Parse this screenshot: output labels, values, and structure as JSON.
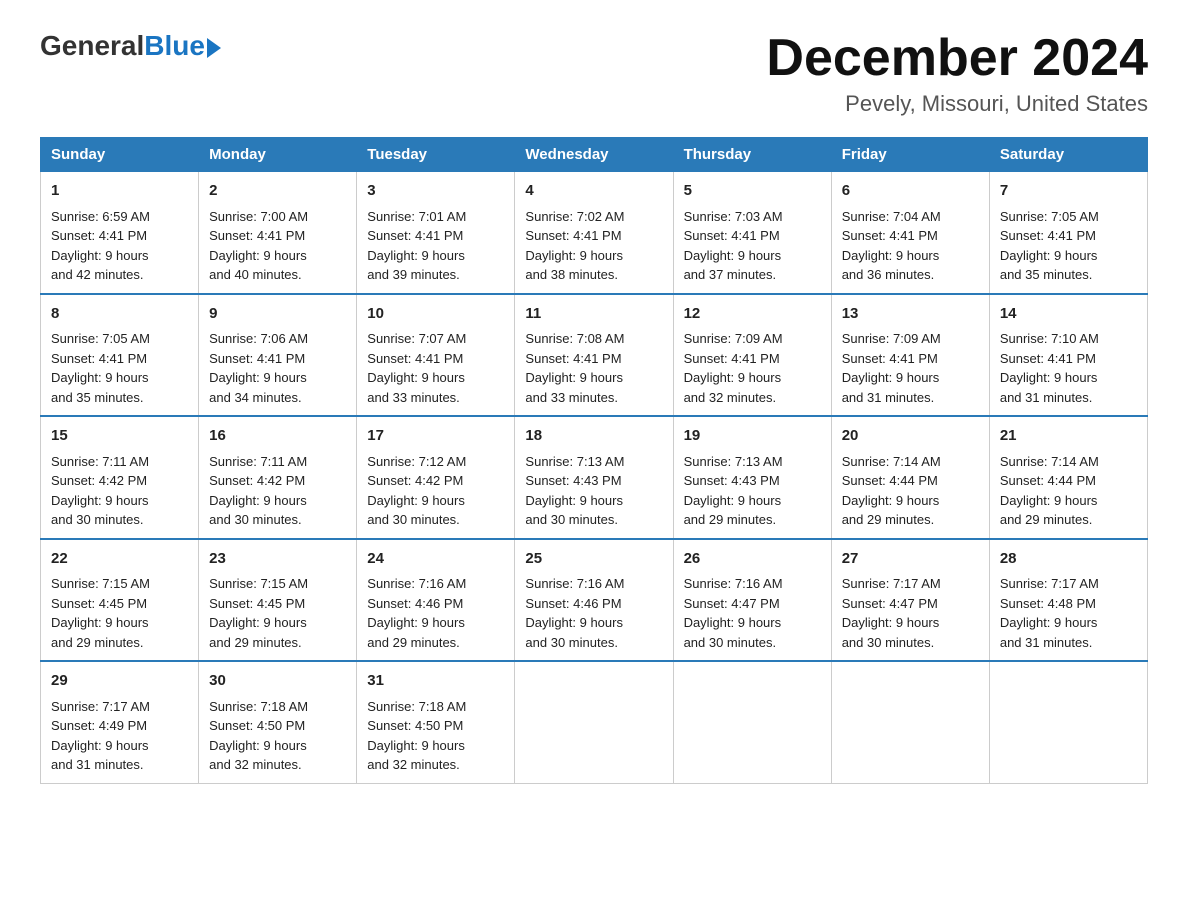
{
  "logo": {
    "general": "General",
    "blue": "Blue"
  },
  "title": "December 2024",
  "location": "Pevely, Missouri, United States",
  "days_of_week": [
    "Sunday",
    "Monday",
    "Tuesday",
    "Wednesday",
    "Thursday",
    "Friday",
    "Saturday"
  ],
  "weeks": [
    [
      {
        "day": "1",
        "sunrise": "6:59 AM",
        "sunset": "4:41 PM",
        "daylight": "9 hours and 42 minutes."
      },
      {
        "day": "2",
        "sunrise": "7:00 AM",
        "sunset": "4:41 PM",
        "daylight": "9 hours and 40 minutes."
      },
      {
        "day": "3",
        "sunrise": "7:01 AM",
        "sunset": "4:41 PM",
        "daylight": "9 hours and 39 minutes."
      },
      {
        "day": "4",
        "sunrise": "7:02 AM",
        "sunset": "4:41 PM",
        "daylight": "9 hours and 38 minutes."
      },
      {
        "day": "5",
        "sunrise": "7:03 AM",
        "sunset": "4:41 PM",
        "daylight": "9 hours and 37 minutes."
      },
      {
        "day": "6",
        "sunrise": "7:04 AM",
        "sunset": "4:41 PM",
        "daylight": "9 hours and 36 minutes."
      },
      {
        "day": "7",
        "sunrise": "7:05 AM",
        "sunset": "4:41 PM",
        "daylight": "9 hours and 35 minutes."
      }
    ],
    [
      {
        "day": "8",
        "sunrise": "7:05 AM",
        "sunset": "4:41 PM",
        "daylight": "9 hours and 35 minutes."
      },
      {
        "day": "9",
        "sunrise": "7:06 AM",
        "sunset": "4:41 PM",
        "daylight": "9 hours and 34 minutes."
      },
      {
        "day": "10",
        "sunrise": "7:07 AM",
        "sunset": "4:41 PM",
        "daylight": "9 hours and 33 minutes."
      },
      {
        "day": "11",
        "sunrise": "7:08 AM",
        "sunset": "4:41 PM",
        "daylight": "9 hours and 33 minutes."
      },
      {
        "day": "12",
        "sunrise": "7:09 AM",
        "sunset": "4:41 PM",
        "daylight": "9 hours and 32 minutes."
      },
      {
        "day": "13",
        "sunrise": "7:09 AM",
        "sunset": "4:41 PM",
        "daylight": "9 hours and 31 minutes."
      },
      {
        "day": "14",
        "sunrise": "7:10 AM",
        "sunset": "4:41 PM",
        "daylight": "9 hours and 31 minutes."
      }
    ],
    [
      {
        "day": "15",
        "sunrise": "7:11 AM",
        "sunset": "4:42 PM",
        "daylight": "9 hours and 30 minutes."
      },
      {
        "day": "16",
        "sunrise": "7:11 AM",
        "sunset": "4:42 PM",
        "daylight": "9 hours and 30 minutes."
      },
      {
        "day": "17",
        "sunrise": "7:12 AM",
        "sunset": "4:42 PM",
        "daylight": "9 hours and 30 minutes."
      },
      {
        "day": "18",
        "sunrise": "7:13 AM",
        "sunset": "4:43 PM",
        "daylight": "9 hours and 30 minutes."
      },
      {
        "day": "19",
        "sunrise": "7:13 AM",
        "sunset": "4:43 PM",
        "daylight": "9 hours and 29 minutes."
      },
      {
        "day": "20",
        "sunrise": "7:14 AM",
        "sunset": "4:44 PM",
        "daylight": "9 hours and 29 minutes."
      },
      {
        "day": "21",
        "sunrise": "7:14 AM",
        "sunset": "4:44 PM",
        "daylight": "9 hours and 29 minutes."
      }
    ],
    [
      {
        "day": "22",
        "sunrise": "7:15 AM",
        "sunset": "4:45 PM",
        "daylight": "9 hours and 29 minutes."
      },
      {
        "day": "23",
        "sunrise": "7:15 AM",
        "sunset": "4:45 PM",
        "daylight": "9 hours and 29 minutes."
      },
      {
        "day": "24",
        "sunrise": "7:16 AM",
        "sunset": "4:46 PM",
        "daylight": "9 hours and 29 minutes."
      },
      {
        "day": "25",
        "sunrise": "7:16 AM",
        "sunset": "4:46 PM",
        "daylight": "9 hours and 30 minutes."
      },
      {
        "day": "26",
        "sunrise": "7:16 AM",
        "sunset": "4:47 PM",
        "daylight": "9 hours and 30 minutes."
      },
      {
        "day": "27",
        "sunrise": "7:17 AM",
        "sunset": "4:47 PM",
        "daylight": "9 hours and 30 minutes."
      },
      {
        "day": "28",
        "sunrise": "7:17 AM",
        "sunset": "4:48 PM",
        "daylight": "9 hours and 31 minutes."
      }
    ],
    [
      {
        "day": "29",
        "sunrise": "7:17 AM",
        "sunset": "4:49 PM",
        "daylight": "9 hours and 31 minutes."
      },
      {
        "day": "30",
        "sunrise": "7:18 AM",
        "sunset": "4:50 PM",
        "daylight": "9 hours and 32 minutes."
      },
      {
        "day": "31",
        "sunrise": "7:18 AM",
        "sunset": "4:50 PM",
        "daylight": "9 hours and 32 minutes."
      },
      null,
      null,
      null,
      null
    ]
  ],
  "sunrise_label": "Sunrise:",
  "sunset_label": "Sunset:",
  "daylight_label": "Daylight:"
}
